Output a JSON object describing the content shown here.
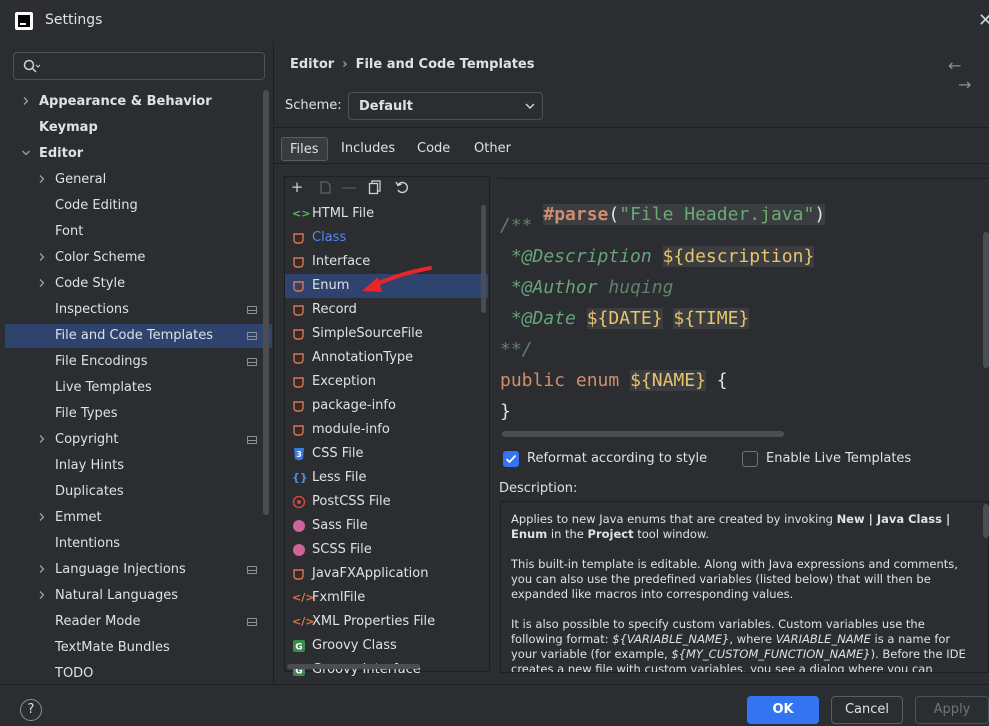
{
  "window": {
    "title": "Settings",
    "close_icon": "close-icon"
  },
  "search": {
    "placeholder": ""
  },
  "sidebar": {
    "items": [
      {
        "label": "Appearance & Behavior",
        "bold": true,
        "expander": "collapsed"
      },
      {
        "label": "Keymap",
        "bold": true
      },
      {
        "label": "Editor",
        "bold": true,
        "expander": "expanded"
      },
      {
        "label": "General",
        "expander": "collapsed"
      },
      {
        "label": "Code Editing"
      },
      {
        "label": "Font"
      },
      {
        "label": "Color Scheme",
        "expander": "collapsed"
      },
      {
        "label": "Code Style",
        "expander": "collapsed"
      },
      {
        "label": "Inspections",
        "project_icon": true
      },
      {
        "label": "File and Code Templates",
        "project_icon": true,
        "selected": true
      },
      {
        "label": "File Encodings",
        "project_icon": true
      },
      {
        "label": "Live Templates"
      },
      {
        "label": "File Types"
      },
      {
        "label": "Copyright",
        "expander": "collapsed",
        "project_icon": true
      },
      {
        "label": "Inlay Hints"
      },
      {
        "label": "Duplicates"
      },
      {
        "label": "Emmet",
        "expander": "collapsed"
      },
      {
        "label": "Intentions"
      },
      {
        "label": "Language Injections",
        "expander": "collapsed",
        "project_icon": true
      },
      {
        "label": "Natural Languages",
        "expander": "collapsed"
      },
      {
        "label": "Reader Mode",
        "project_icon": true
      },
      {
        "label": "TextMate Bundles"
      },
      {
        "label": "TODO"
      }
    ]
  },
  "breadcrumb": {
    "parent": "Editor",
    "separator": "›",
    "current": "File and Code Templates"
  },
  "nav": {
    "back": "←",
    "forward": "→"
  },
  "scheme": {
    "label": "Scheme:",
    "value": "Default"
  },
  "tabs": [
    {
      "label": "Files",
      "active": true
    },
    {
      "label": "Includes"
    },
    {
      "label": "Code"
    },
    {
      "label": "Other"
    }
  ],
  "toolbar_icons": [
    "plus-icon",
    "copy-icon",
    "minus-icon",
    "duplicate-icon",
    "reset-icon"
  ],
  "templates": [
    {
      "label": "HTML File",
      "icon": "html-icon"
    },
    {
      "label": "Class",
      "icon": "java-icon",
      "link": true
    },
    {
      "label": "Interface",
      "icon": "java-icon"
    },
    {
      "label": "Enum",
      "icon": "java-icon",
      "selected": true
    },
    {
      "label": "Record",
      "icon": "java-icon"
    },
    {
      "label": "SimpleSourceFile",
      "icon": "java-icon"
    },
    {
      "label": "AnnotationType",
      "icon": "java-icon"
    },
    {
      "label": "Exception",
      "icon": "java-icon"
    },
    {
      "label": "package-info",
      "icon": "java-icon"
    },
    {
      "label": "module-info",
      "icon": "java-icon"
    },
    {
      "label": "CSS File",
      "icon": "css-icon"
    },
    {
      "label": "Less File",
      "icon": "less-icon"
    },
    {
      "label": "PostCSS File",
      "icon": "postcss-icon"
    },
    {
      "label": "Sass File",
      "icon": "sass-icon"
    },
    {
      "label": "SCSS File",
      "icon": "sass-icon"
    },
    {
      "label": "JavaFXApplication",
      "icon": "java-icon"
    },
    {
      "label": "FxmlFile",
      "icon": "xml-icon"
    },
    {
      "label": "XML Properties File",
      "icon": "xml-icon"
    },
    {
      "label": "Groovy Class",
      "icon": "groovy-icon"
    },
    {
      "label": "Groovy Interface",
      "icon": "groovy-icon"
    }
  ],
  "code": {
    "line1_kw": "#parse",
    "line1_open": "(",
    "line1_str": "\"File Header.java\"",
    "line1_close": ")",
    "line2": "/**",
    "line3_tag": " *@Description",
    "line3_var": "${description}",
    "line4_tag": " *@Author",
    "line4_val": "huqing",
    "line5_tag": " *@Date",
    "line5_var1": "${DATE}",
    "line5_var2": "${TIME}",
    "line6": "**/",
    "line7_kw": "public enum",
    "line7_var": "${NAME}",
    "line7_brace": "{",
    "line8": "}"
  },
  "options": {
    "reformat": {
      "label": "Reformat according to style",
      "checked": true
    },
    "live_templates": {
      "label": "Enable Live Templates",
      "checked": false
    }
  },
  "description": {
    "label": "Description:",
    "p1_a": "Applies to new Java enums that are created by invoking ",
    "p1_b": "New | Java Class | Enum",
    "p1_c": " in the ",
    "p1_d": "Project",
    "p1_e": " tool window.",
    "p2": "This built-in template is editable. Along with Java expressions and comments, you can also use the predefined variables (listed below) that will then be expanded like macros into corresponding values.",
    "p3_a": "It is also possible to specify custom variables. Custom variables use the following format: ",
    "p3_b": "${VARIABLE_NAME}",
    "p3_c": ", where ",
    "p3_d": "VARIABLE_NAME",
    "p3_e": " is a name for your variable (for example, ",
    "p3_f": "${MY_CUSTOM_FUNCTION_NAME}",
    "p3_g": "). Before the IDE creates a new file with custom variables, you see a dialog where you can"
  },
  "footer": {
    "help": "?",
    "ok": "OK",
    "cancel": "Cancel",
    "apply": "Apply"
  },
  "colors": {
    "accent": "#3574f0",
    "selection": "#2e436e",
    "background": "#2b2d30",
    "annotation_arrow": "#e8262a"
  }
}
